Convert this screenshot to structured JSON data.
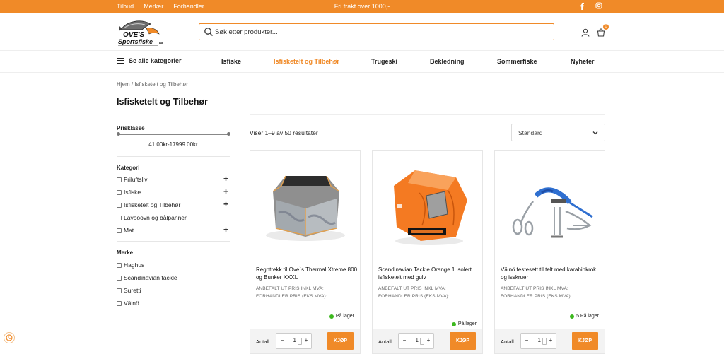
{
  "topbar": {
    "links": [
      "Tilbud",
      "Merker",
      "Forhandler"
    ],
    "promo": "Fri frakt over 1000,-",
    "social": [
      "facebook-icon",
      "instagram-icon"
    ]
  },
  "header": {
    "logo_text_1": "OVE'S",
    "logo_text_2": "Sportsfiske",
    "logo_text_3": "as",
    "search_placeholder": "Søk etter produkter...",
    "cart_count": "0"
  },
  "nav": {
    "all_categories": "Se alle kategorier",
    "items": [
      "Isfiske",
      "Isfisketelt og Tilbehør",
      "Trugeski",
      "Bekledning",
      "Sommerfiske",
      "Nyheter"
    ],
    "active": "Isfisketelt og Tilbehør"
  },
  "breadcrumb": "Hjem / Isfisketelt og Tilbehør",
  "page_title": "Isfisketelt og Tilbehør",
  "sidebar": {
    "price_label": "Prisklasse",
    "price_range": "41.00kr-17999.00kr",
    "price_slider": {
      "min": 41.0,
      "max": 17999.0,
      "from": 41.0,
      "to": 17999.0
    },
    "category_label": "Kategori",
    "categories": [
      {
        "label": "Friluftsliv",
        "has_children": true
      },
      {
        "label": "Isfiske",
        "has_children": true
      },
      {
        "label": "Isfisketelt og Tilbehør",
        "has_children": true
      },
      {
        "label": "Lavooovn og bålpanner",
        "has_children": false
      },
      {
        "label": "Mat",
        "has_children": true
      }
    ],
    "brand_label": "Merke",
    "brands": [
      "Haghus",
      "Scandinavian tackle",
      "Suretti",
      "Väinö"
    ]
  },
  "results": {
    "count_text": "Viser 1–9 av 50 resultater",
    "sort_selected": "Standard"
  },
  "products": [
    {
      "name": "Regntrekk til Ove`s Thermal Xtreme 800 og Bunker XXXL",
      "meta_1": "ANBEFALT UT PRIS INKL MVA:",
      "meta_2": "FORHANDLER PRIS (EKS MVA):",
      "stock": "På lager",
      "qty_label": "Antall",
      "qty": "1",
      "buy": "KJØP"
    },
    {
      "name": "Scandinavian Tackle Orange 1 isolert isfisketelt med gulv",
      "meta_1": "ANBEFALT UT PRIS INKL MVA:",
      "meta_2": "FORHANDLER PRIS (EKS MVA):",
      "stock": "På lager",
      "qty_label": "Antall",
      "qty": "1",
      "buy": "KJØP"
    },
    {
      "name": "Väinö festesett til telt med karabinkrok og isskruer",
      "meta_1": "ANBEFALT UT PRIS INKL MVA:",
      "meta_2": "FORHANDLER PRIS (EKS MVA):",
      "stock": "5 På lager",
      "qty_label": "Antall",
      "qty": "1",
      "buy": "KJØP"
    }
  ],
  "colors": {
    "accent": "#f08a28",
    "in_stock": "#3cb81e"
  }
}
